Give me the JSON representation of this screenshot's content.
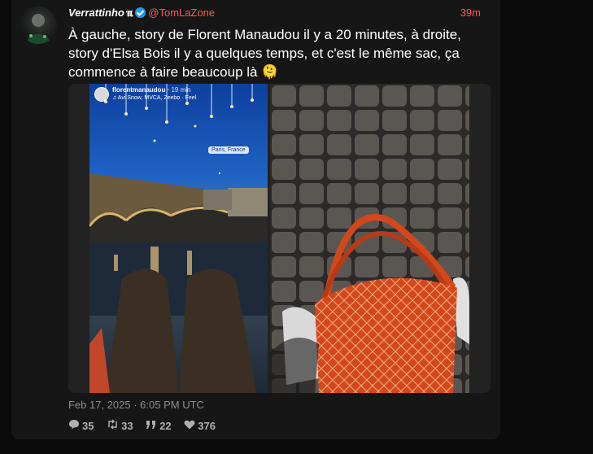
{
  "post": {
    "display_name": "Verrattinho",
    "name_badge": "ℼ",
    "handle": "@TomLaZone",
    "time": "39m",
    "text": "À gauche, story de Florent Manaudou il y a 20 minutes, à droite, story d'Elsa Bois il y a quelques temps, et c'est le même sac, ça commence à faire beaucoup là 🫠",
    "date": "Feb 17, 2025 · 6:05 PM UTC"
  },
  "story": {
    "username": "florentmanaudou",
    "age": "19 min",
    "music": "♫ Avi Snow, MVCA, Zeebo · Feel",
    "location": "Paris, France"
  },
  "stats": {
    "replies": "35",
    "retweets": "33",
    "quotes": "22",
    "likes": "376"
  },
  "icons": {
    "reply": "comment-icon",
    "retweet": "retweet-icon",
    "quote": "quote-icon",
    "like": "heart-icon",
    "verified": "verified-icon"
  },
  "colors": {
    "accent": "#ff5a4a",
    "verified": "#1d9bf0",
    "card_bg": "#161617"
  }
}
